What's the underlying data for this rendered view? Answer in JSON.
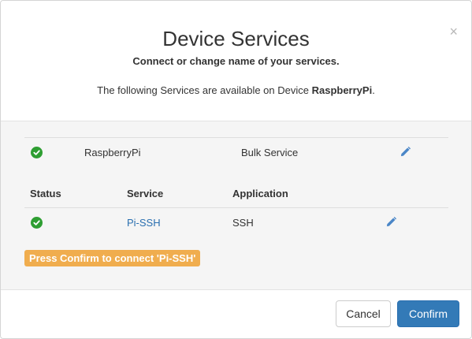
{
  "modal": {
    "close_symbol": "×",
    "title": "Device Services",
    "subtitle": "Connect or change name of your services.",
    "description_prefix": "The following Services are available on Device ",
    "device_name": "RaspberryPi",
    "description_suffix": "."
  },
  "device_row": {
    "status": "ok",
    "name": "RaspberryPi",
    "service_type": "Bulk Service"
  },
  "table": {
    "headers": {
      "status": "Status",
      "service": "Service",
      "application": "Application"
    },
    "rows": [
      {
        "status": "ok",
        "service": "Pi-SSH",
        "application": "SSH"
      }
    ]
  },
  "notice": "Press Confirm to connect 'Pi-SSH'",
  "footer": {
    "cancel_label": "Cancel",
    "confirm_label": "Confirm"
  },
  "colors": {
    "status_ok": "#2e9e32",
    "link": "#2a6fb0",
    "notice_bg": "#f0ad4e",
    "primary": "#337ab7"
  }
}
